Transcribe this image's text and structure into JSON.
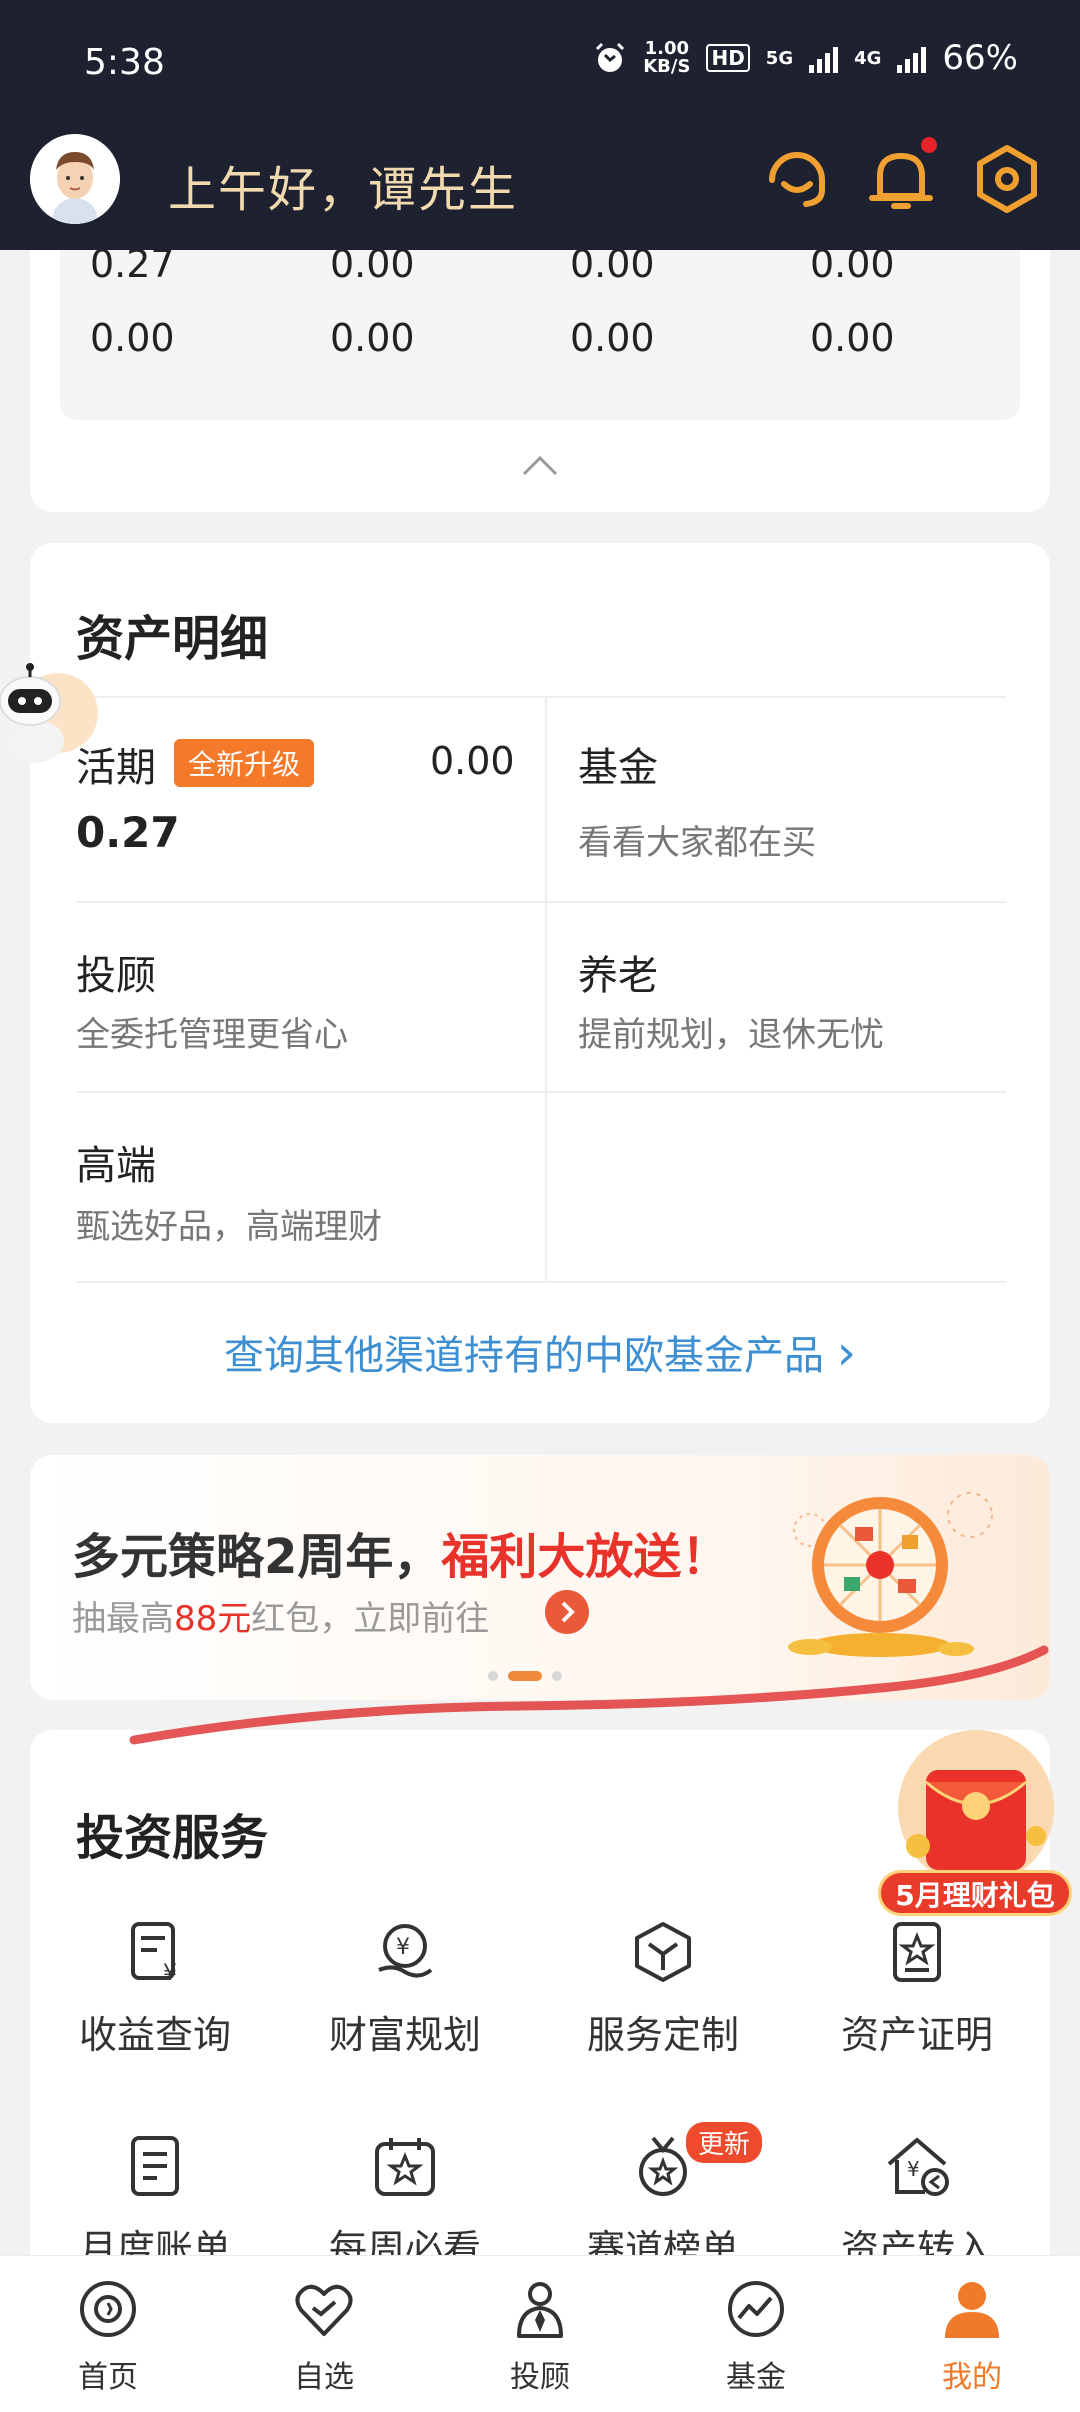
{
  "status_bar": {
    "time": "5:38",
    "speed_value": "1.00",
    "speed_unit": "KB/S",
    "hd": "HD",
    "net1": "5G",
    "net2": "4G",
    "battery": "66%"
  },
  "header": {
    "greeting": "上午好，谭先生",
    "icons": [
      "customer-service-icon",
      "bell-icon",
      "settings-icon"
    ],
    "has_notification": true
  },
  "balance": {
    "row1": [
      "0.27",
      "0.00",
      "0.00",
      "0.00"
    ],
    "row2": [
      "0.00",
      "0.00",
      "0.00",
      "0.00"
    ]
  },
  "asset_detail": {
    "title": "资产明细",
    "current": {
      "title": "活期",
      "badge": "全新升级",
      "right_value": "0.00",
      "value": "0.27"
    },
    "fund": {
      "title": "基金",
      "sub": "看看大家都在买"
    },
    "advisor": {
      "title": "投顾",
      "sub": "全委托管理更省心"
    },
    "pension": {
      "title": "养老",
      "sub": "提前规划，退休无忧"
    },
    "premium": {
      "title": "高端",
      "sub": "甄选好品，高端理财"
    },
    "query_link": "查询其他渠道持有的中欧基金产品",
    "query_chevron": "›"
  },
  "banner": {
    "title_prefix": "多元策略2周年，",
    "title_highlight": "福利大放送！",
    "sub_prefix": "抽最高",
    "sub_highlight": "88元",
    "sub_suffix": "红包，立即前往",
    "pages": 3,
    "active_page": 1
  },
  "services": {
    "title": "投资服务",
    "items": [
      {
        "label": "收益查询",
        "icon": "income-query-icon"
      },
      {
        "label": "财富规划",
        "icon": "wealth-plan-icon"
      },
      {
        "label": "服务定制",
        "icon": "service-custom-icon"
      },
      {
        "label": "资产证明",
        "icon": "asset-proof-icon"
      },
      {
        "label": "月度账单",
        "icon": "monthly-bill-icon"
      },
      {
        "label": "每周必看",
        "icon": "weekly-calendar-icon"
      },
      {
        "label": "赛道榜单",
        "icon": "ranking-medal-icon",
        "badge": "更新"
      },
      {
        "label": "资产转入",
        "icon": "asset-transfer-icon"
      }
    ]
  },
  "gift": {
    "label": "5月理财礼包"
  },
  "bottom_nav": {
    "items": [
      {
        "label": "首页",
        "icon": "home-icon"
      },
      {
        "label": "自选",
        "icon": "watchlist-heart-icon"
      },
      {
        "label": "投顾",
        "icon": "advisor-icon"
      },
      {
        "label": "基金",
        "icon": "fund-chart-icon"
      },
      {
        "label": "我的",
        "icon": "profile-icon",
        "active": true
      }
    ]
  },
  "colors": {
    "header_bg": "#1d2130",
    "accent_orange": "#f07a2a",
    "link_blue": "#3d8fd1",
    "highlight_red": "#e8322a"
  }
}
